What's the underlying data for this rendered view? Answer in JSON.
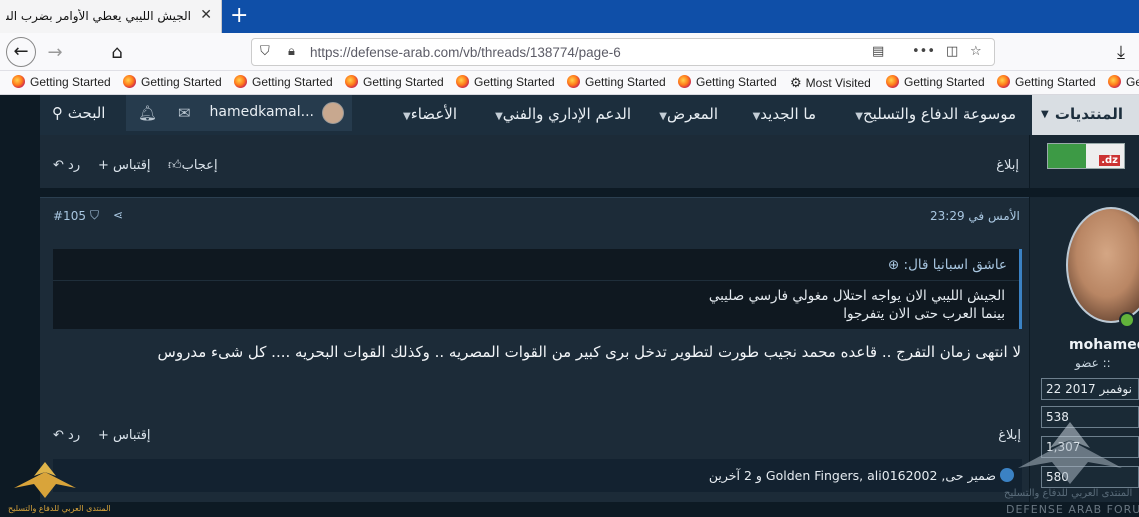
{
  "browser": {
    "tab_title": "الجيش الليبي يعطي الأوامر بضرب السفن ال",
    "url": "https://defense-arab.com/vb/threads/138774/page-6",
    "bookmarks": [
      "Getting Started",
      "Getting Started",
      "Getting Started",
      "Getting Started",
      "Getting Started",
      "Getting Started",
      "Getting Started",
      "Most Visited",
      "Getting Started",
      "Getting Started",
      "Getting"
    ]
  },
  "nav": {
    "forums": "المنتديات",
    "encyclopedia": "موسوعة الدفاع والتسليح",
    "whats_new": "ما الجديد",
    "gallery": "المعرض",
    "support": "الدعم الإداري والفني",
    "members": "الأعضاء",
    "username": "hamedkamal...",
    "search": "البحث"
  },
  "post_prev": {
    "report": "إبلاغ",
    "like": "إعجاب",
    "quote": "+ إقتباس",
    "reply": "رد",
    "flag_text": ".dz"
  },
  "post": {
    "timestamp": "الأمس في 23:29",
    "number": "#105",
    "quote_author": "عاشق اسبانيا قال:",
    "quote_line1": "الجيش الليبي الان يواجه احتلال مغولي فارسي صليبي",
    "quote_line2": "بينما العرب حتى الان يتفرجوا",
    "body": "لا انتهى زمان التفرج .. قاعده محمد نجيب طورت لتطوير تدخل برى كبير من القوات المصريه .. وكذلك القوات البحريه .... كل شىء مدروس",
    "report": "إبلاغ",
    "quote": "+ إقتباس",
    "reply": "رد",
    "reactions": "ضمير حى, Golden Fingers, ali0162002 و 2 آخرين"
  },
  "author": {
    "name": "mohamed",
    "role": ":: عضو",
    "joined": "22 نوفمبر 2017",
    "stat1": "538",
    "stat2": "1,307",
    "stat3": "580"
  },
  "watermark": {
    "left_text": "المنتدى العربي للدفاع والتسليح",
    "right_text_ar": "المنتدى العربي للدفاع والتسليح",
    "right_text_en": "DEFENSE ARAB FORUM"
  },
  "colors": {
    "accent": "#3b82c4",
    "nav_bg": "#1c2e3d",
    "page_bg": "#0d1a24"
  }
}
